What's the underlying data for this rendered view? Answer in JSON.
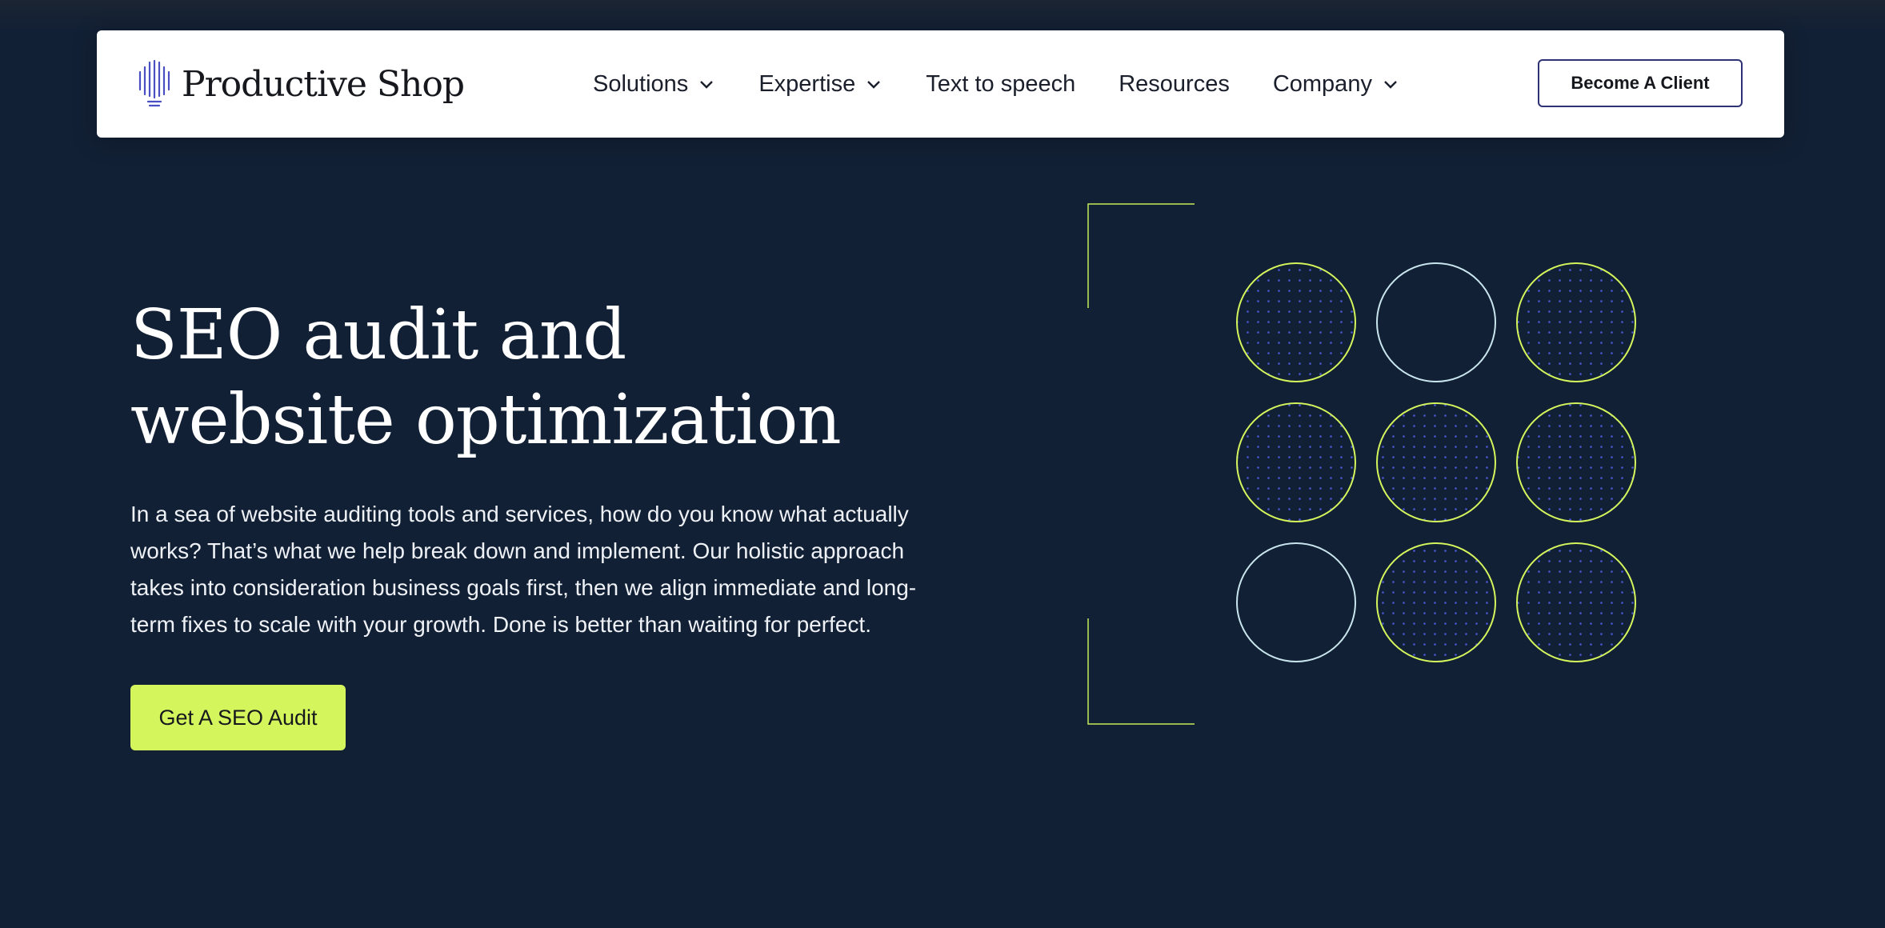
{
  "header": {
    "brand": "Productive Shop",
    "nav": [
      {
        "label": "Solutions",
        "has_dropdown": true
      },
      {
        "label": "Expertise",
        "has_dropdown": true
      },
      {
        "label": "Text to speech",
        "has_dropdown": false
      },
      {
        "label": "Resources",
        "has_dropdown": false
      },
      {
        "label": "Company",
        "has_dropdown": true
      }
    ],
    "cta_label": "Become A Client"
  },
  "hero": {
    "title_lines": [
      "SEO audit and",
      "website optimization"
    ],
    "description_lines": [
      "In a sea of website auditing tools and services, how do you know what actually",
      "works? That’s what we help break down and implement. Our holistic approach",
      "takes into consideration business goals first, then we align immediate and long-",
      "term fixes to scale with your growth. Done is better than waiting for perfect."
    ],
    "cta_label": "Get A SEO Audit"
  },
  "colors": {
    "background": "#122035",
    "accent_lime": "#d4f55c",
    "accent_indigo": "#2e3175",
    "circle_pale": "#c9e6ee",
    "dot_blue": "#4b58d6"
  },
  "graphic": {
    "circles": [
      {
        "row": 1,
        "col": 1,
        "style": "dotted-lime"
      },
      {
        "row": 1,
        "col": 2,
        "style": "outline-pale"
      },
      {
        "row": 1,
        "col": 3,
        "style": "dotted-lime"
      },
      {
        "row": 2,
        "col": 1,
        "style": "dotted-lime"
      },
      {
        "row": 2,
        "col": 2,
        "style": "dotted-lime"
      },
      {
        "row": 2,
        "col": 3,
        "style": "dotted-lime"
      },
      {
        "row": 3,
        "col": 1,
        "style": "outline-pale"
      },
      {
        "row": 3,
        "col": 2,
        "style": "dotted-lime"
      },
      {
        "row": 3,
        "col": 3,
        "style": "dotted-lime"
      }
    ]
  }
}
